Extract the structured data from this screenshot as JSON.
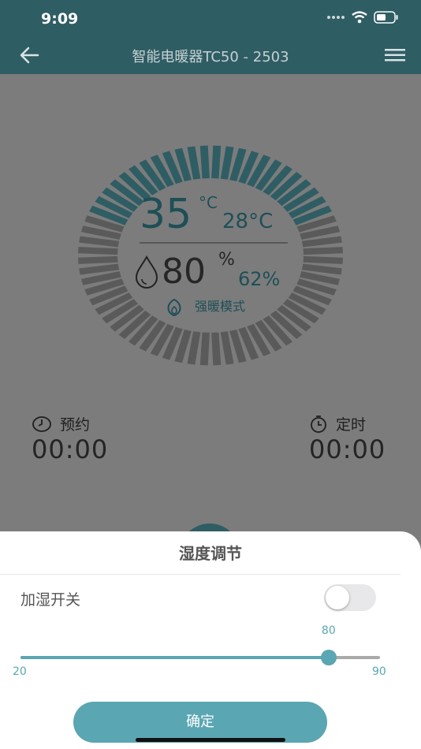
{
  "status_bar": {
    "time": "9:09"
  },
  "nav": {
    "title": "智能电暖器TC50 - 2503"
  },
  "dial": {
    "set_temp": "35",
    "temp_unit": "°C",
    "current_temp": "28°C",
    "set_humidity": "80",
    "humidity_unit": "%",
    "current_humidity": "62%",
    "mode_label": "强暖模式",
    "segments_total": 64,
    "segments_active": 24,
    "colors": {
      "active": "#2f5d64",
      "inactive": "#5a5a5a"
    }
  },
  "reserve": {
    "label": "预约",
    "value": "00:00"
  },
  "timer": {
    "label": "定时",
    "value": "00:00"
  },
  "sheet": {
    "title": "湿度调节",
    "humidify_label": "加湿开关",
    "humidify_on": false,
    "slider": {
      "min": 20,
      "max": 90,
      "value": 80,
      "min_label": "20",
      "max_label": "90",
      "value_label": "80"
    },
    "confirm_label": "确定"
  },
  "colors": {
    "accent": "#5aa6b2",
    "header": "#2f5d64",
    "overlay": "#7c7c7c"
  }
}
